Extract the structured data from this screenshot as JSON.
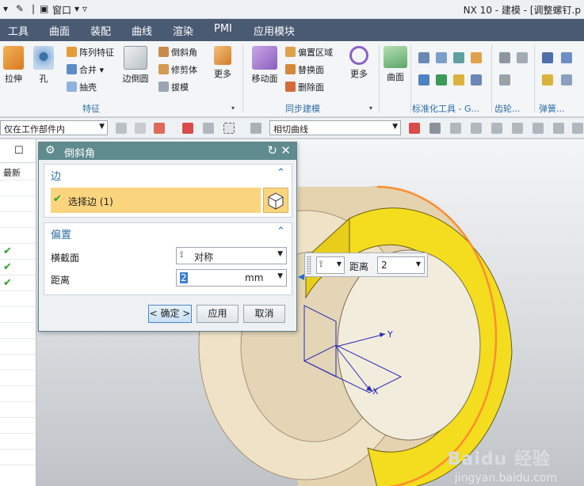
{
  "titlebar": {
    "window_menu": "窗口",
    "app_title": "NX 10 - 建模 - [调整螺钉.p"
  },
  "menu": {
    "tabs": [
      "工具",
      "曲面",
      "装配",
      "曲线",
      "渲染",
      "PMI",
      "应用模块"
    ]
  },
  "ribbon": {
    "feature_buttons": {
      "extrude": "拉伸",
      "hole": "孔",
      "edge_blend": "边倒圆",
      "more1": "更多"
    },
    "feature_small": {
      "pattern": "阵列特征",
      "unite": "合并",
      "shell": "抽壳",
      "chamfer": "倒斜角",
      "trim_body": "修剪体",
      "draft": "拔模"
    },
    "group_feature": "特征",
    "sync_buttons": {
      "move_face": "移动面",
      "more2": "更多"
    },
    "sync_small": {
      "offset_region": "偏置区域",
      "replace_face": "替换面",
      "delete_face": "删除面"
    },
    "group_sync": "同步建模",
    "surface_button": "曲面",
    "group_standard": "标准化工具 - G...",
    "group_gear": "齿轮...",
    "group_spring": "弹簧..."
  },
  "filterbar": {
    "scope": "仅在工作部件内",
    "curve_rule": "相切曲线"
  },
  "navigator": {
    "column_header": "最新",
    "checked_rows": [
      7,
      8,
      9
    ]
  },
  "dialog": {
    "title": "倒斜角",
    "edge_section": {
      "label": "边",
      "select_label": "选择边 (1)"
    },
    "offset_section": {
      "label": "偏置",
      "cross_section_label": "横截面",
      "cross_section_value": "对称",
      "distance_label": "距离",
      "distance_value": "2",
      "distance_unit": "mm"
    },
    "buttons": {
      "ok": "< 确定 >",
      "apply": "应用",
      "cancel": "取消"
    }
  },
  "onscreen_input": {
    "distance_label": "距离",
    "distance_value": "2"
  },
  "viewport": {
    "axis_x": "X",
    "axis_y": "Y"
  },
  "watermark": {
    "brand": "Baidu 经验",
    "url": "jingyan.baidu.com"
  },
  "colors": {
    "menubar": "#4a5a73",
    "dialog_title": "#5f8a8e",
    "selection": "#fbd47e",
    "accent": "#2d6ea6",
    "highlight_face": "#f5e21a",
    "edge_highlight": "#ff8c30"
  }
}
